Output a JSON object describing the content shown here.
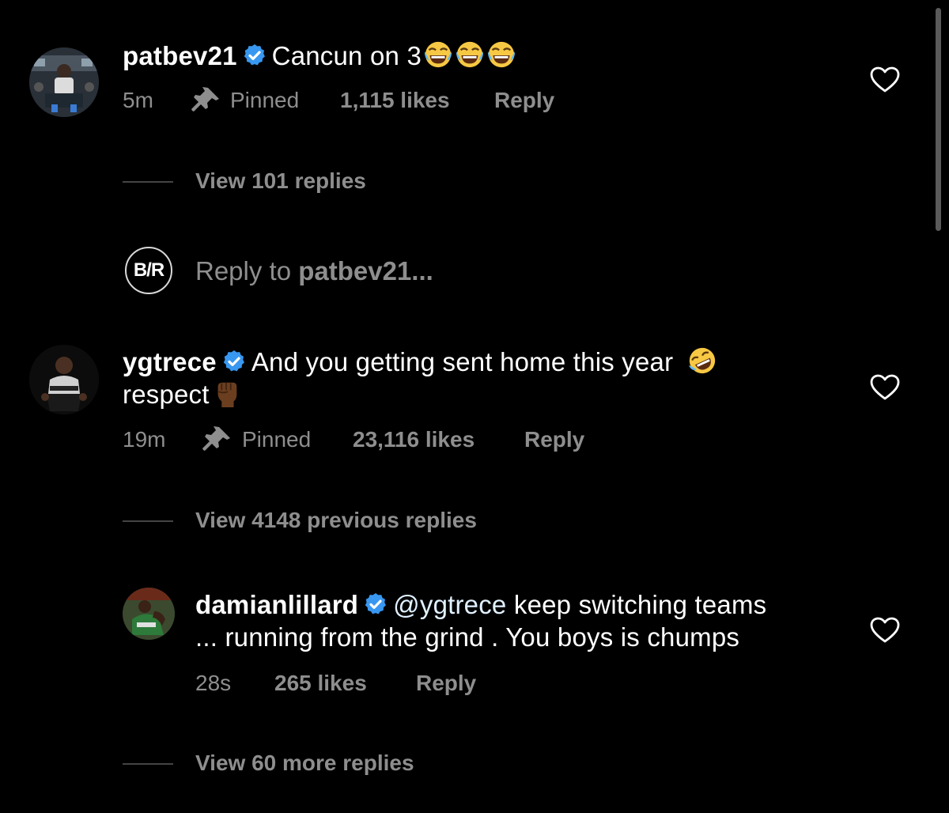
{
  "comments": [
    {
      "username": "patbev21",
      "text": "Cancun on 3",
      "emoji": [
        "face-with-tears-of-joy",
        "face-with-tears-of-joy",
        "face-with-tears-of-joy"
      ],
      "time": "5m",
      "pinned_label": "Pinned",
      "likes": "1,115 likes",
      "reply_label": "Reply",
      "view_replies": "View 101 replies"
    },
    {
      "username": "ygtrece",
      "text_line1": "And you getting sent home this year",
      "text_line2": "respect",
      "emoji": [
        "rolling-on-the-floor-laughing",
        "raised-fist-dark-skin-tone"
      ],
      "time": "19m",
      "pinned_label": "Pinned",
      "likes": "23,116 likes",
      "reply_label": "Reply",
      "view_replies": "View 4148 previous replies"
    },
    {
      "username": "damianlillard",
      "mention": "@ygtrece",
      "text_line1": "keep switching teams",
      "text_line2": "... running from the grind . You boys is chumps",
      "time": "28s",
      "likes": "265 likes",
      "reply_label": "Reply",
      "view_replies": "View 60 more replies"
    }
  ],
  "composer": {
    "logo_text": "B/R",
    "prefix": "Reply to",
    "target": "patbev21..."
  },
  "icons": {
    "verified": "verified-badge-icon",
    "pin": "pin-icon",
    "like": "heart-outline-icon"
  },
  "colors": {
    "background": "#000000",
    "primary_text": "#ffffff",
    "secondary_text": "#8e8e8e",
    "verified_badge": "#3897f0",
    "divider": "#444444"
  }
}
